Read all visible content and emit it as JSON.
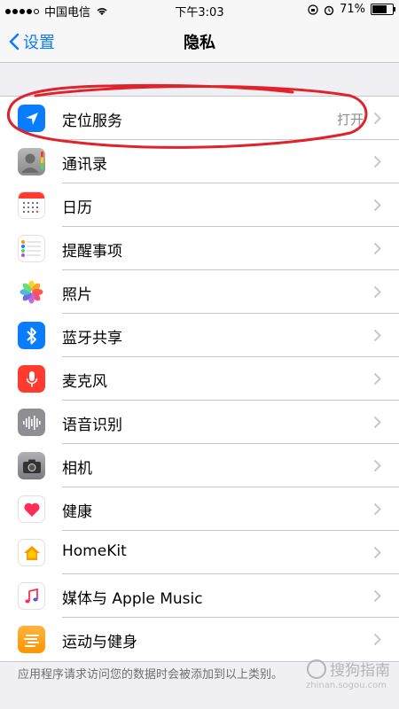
{
  "status": {
    "carrier": "中国电信",
    "time": "下午3:03",
    "battery": "71%"
  },
  "nav": {
    "back_label": "设置",
    "title": "隐私"
  },
  "rows": [
    {
      "label": "定位服务",
      "value": "打开",
      "icon": "location-arrow-icon",
      "color": "#0a7cff"
    },
    {
      "label": "通讯录",
      "value": "",
      "icon": "contacts-icon",
      "color": "#9a9a9a"
    },
    {
      "label": "日历",
      "value": "",
      "icon": "calendar-icon",
      "color": "#ffffff"
    },
    {
      "label": "提醒事项",
      "value": "",
      "icon": "reminders-icon",
      "color": "#ffffff"
    },
    {
      "label": "照片",
      "value": "",
      "icon": "photos-icon",
      "color": "#ffffff"
    },
    {
      "label": "蓝牙共享",
      "value": "",
      "icon": "bluetooth-icon",
      "color": "#0a7cff"
    },
    {
      "label": "麦克风",
      "value": "",
      "icon": "microphone-icon",
      "color": "#ff3b30"
    },
    {
      "label": "语音识别",
      "value": "",
      "icon": "speech-recognition-icon",
      "color": "#8e8e93"
    },
    {
      "label": "相机",
      "value": "",
      "icon": "camera-icon",
      "color": "#8e8e93"
    },
    {
      "label": "健康",
      "value": "",
      "icon": "health-heart-icon",
      "color": "#ffffff"
    },
    {
      "label": "HomeKit",
      "value": "",
      "icon": "homekit-icon",
      "color": "#ffffff"
    },
    {
      "label": "媒体与 Apple Music",
      "value": "",
      "icon": "music-note-icon",
      "color": "#ffffff"
    },
    {
      "label": "运动与健身",
      "value": "",
      "icon": "motion-fitness-icon",
      "color": "#ff9500"
    }
  ],
  "footer": "应用程序请求访问您的数据时会被添加到以上类别。",
  "watermark": {
    "text": "搜狗指南",
    "url": "zhinan.sogou.com"
  }
}
